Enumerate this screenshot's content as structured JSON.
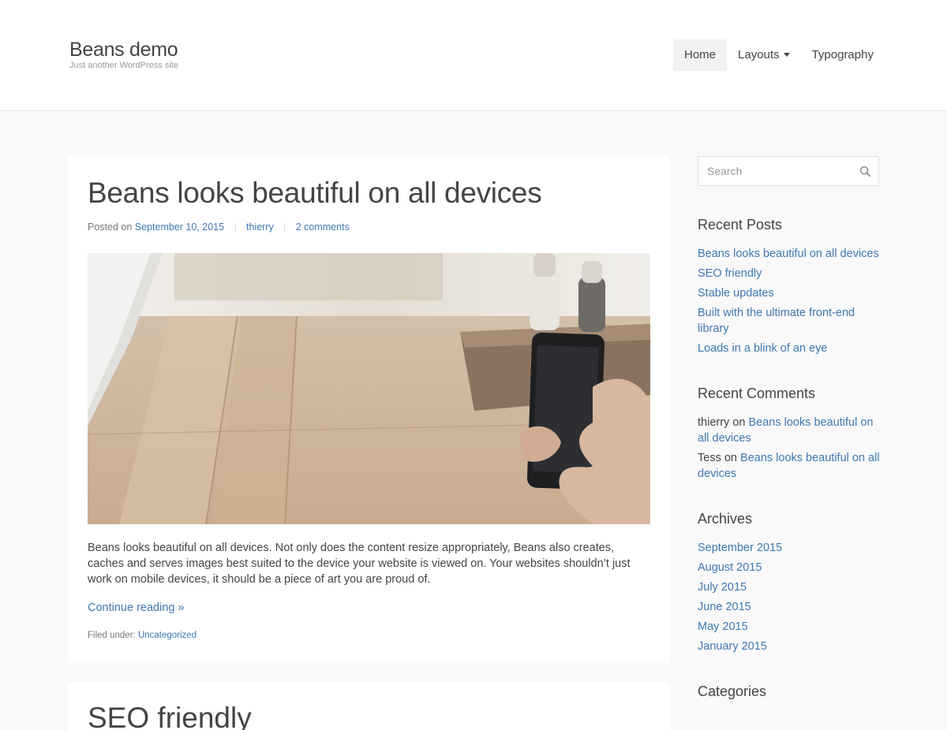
{
  "site": {
    "title": "Beans demo",
    "tagline": "Just another WordPress site"
  },
  "nav": {
    "items": [
      {
        "label": "Home",
        "active": true
      },
      {
        "label": "Layouts",
        "dropdown": true
      },
      {
        "label": "Typography"
      }
    ]
  },
  "post": {
    "title": "Beans looks beautiful on all devices",
    "meta": {
      "posted_on_label": "Posted on",
      "date": "September 10, 2015",
      "author": "thierry",
      "comments": "2 comments"
    },
    "image_alt": "hand holding smartphone over wooden desk",
    "excerpt": "Beans looks beautiful on all devices. Not only does the content resize appropriately, Beans also creates, caches and serves images best suited to the device your website is viewed on. Your websites shouldn’t just work on mobile devices, it should be a piece of art you are proud of.",
    "continue_label": "Continue reading »",
    "filed_label": "Filed under:",
    "category": "Uncategorized"
  },
  "next_post": {
    "title": "SEO friendly"
  },
  "sidebar": {
    "search": {
      "placeholder": "Search"
    },
    "recent_posts": {
      "title": "Recent Posts",
      "items": [
        "Beans looks beautiful on all devices",
        "SEO friendly",
        "Stable updates",
        "Built with the ultimate front-end library",
        "Loads in a blink of an eye"
      ]
    },
    "recent_comments": {
      "title": "Recent Comments",
      "items": [
        {
          "author": "thierry",
          "on": "on",
          "post": "Beans looks beautiful on all devices"
        },
        {
          "author": "Tess",
          "on": "on",
          "post": "Beans looks beautiful on all devices"
        }
      ]
    },
    "archives": {
      "title": "Archives",
      "items": [
        "September 2015",
        "August 2015",
        "July 2015",
        "June 2015",
        "May 2015",
        "January 2015"
      ]
    },
    "categories": {
      "title": "Categories"
    }
  },
  "colors": {
    "link": "#3f77b2",
    "text": "#444444",
    "background": "#f9f9f9"
  }
}
